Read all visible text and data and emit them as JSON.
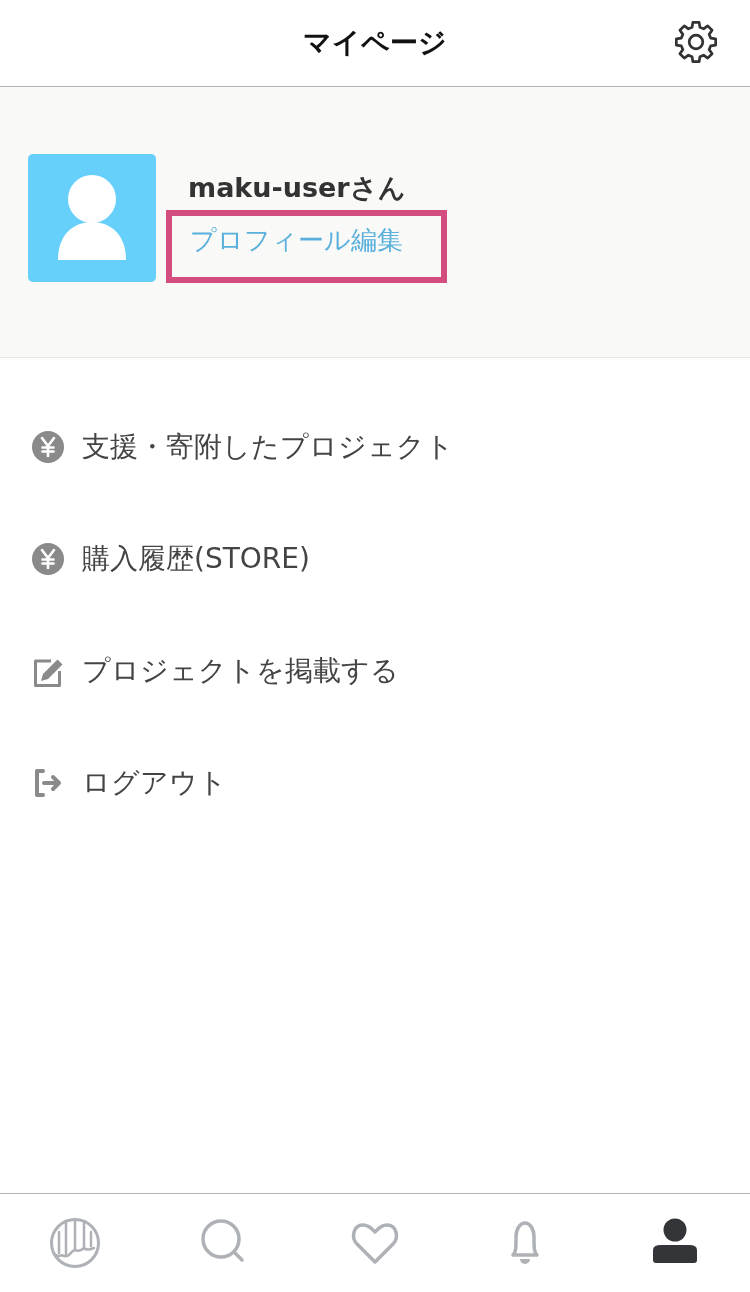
{
  "header": {
    "title": "マイページ"
  },
  "profile": {
    "name": "maku-userさん",
    "edit_link": "プロフィール編集",
    "highlighted": true
  },
  "menu": [
    {
      "kind": "yen",
      "label": "支援・寄附したプロジェクト"
    },
    {
      "kind": "yen",
      "label": "購入履歴(STORE)"
    },
    {
      "kind": "edit",
      "label": "プロジェクトを掲載する"
    },
    {
      "kind": "logout",
      "label": "ログアウト"
    }
  ],
  "tab_bar": [
    {
      "kind": "home",
      "selected": false
    },
    {
      "kind": "search",
      "selected": false
    },
    {
      "kind": "favorites",
      "selected": false
    },
    {
      "kind": "notifications",
      "selected": false
    },
    {
      "kind": "mypage",
      "selected": true
    }
  ]
}
